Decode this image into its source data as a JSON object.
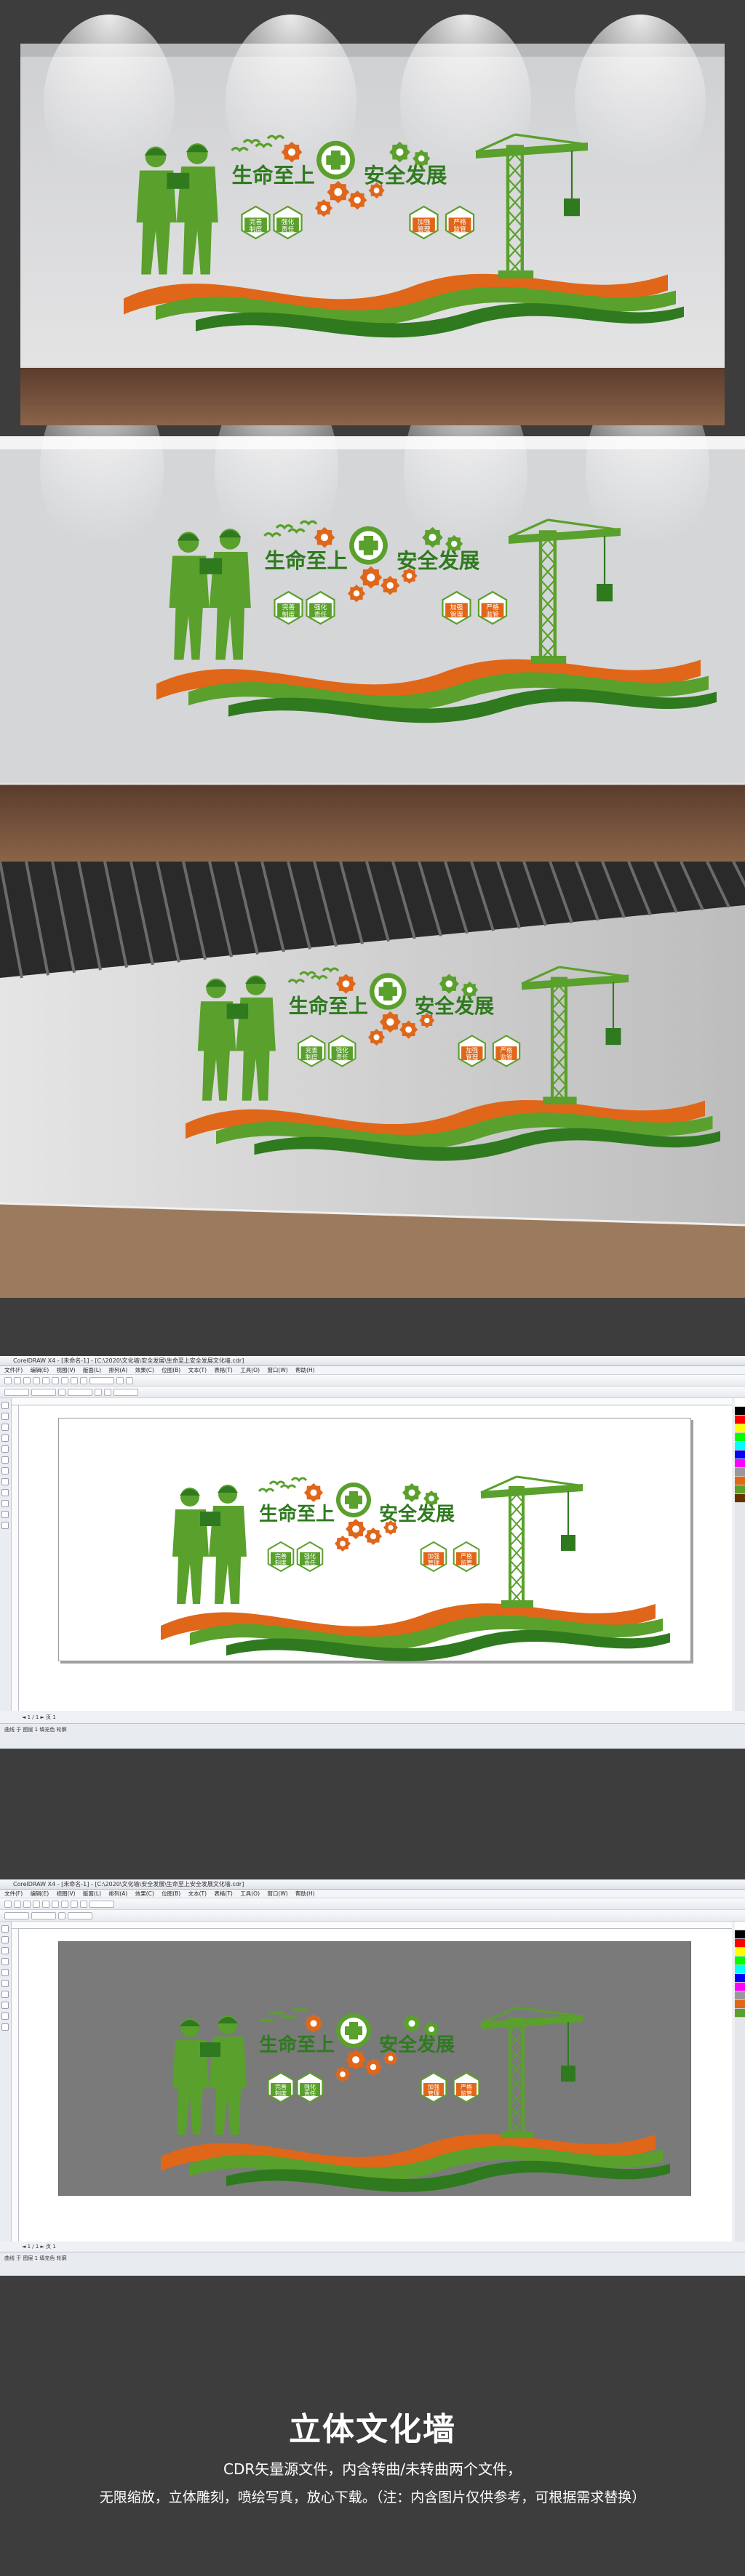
{
  "wall": {
    "slogan_left": "生命至上",
    "slogan_right": "安全发展",
    "hex_labels": [
      [
        "完善",
        "制度"
      ],
      [
        "强化",
        "责任"
      ],
      [
        "加强",
        "管理"
      ],
      [
        "严格",
        "监管"
      ]
    ]
  },
  "cdr": {
    "title": "CorelDRAW X4 - [未命名-1] - [C:\\2020\\文化墙\\安全发展\\生命至上安全发展文化墙.cdr]",
    "menus": [
      "文件(F)",
      "编辑(E)",
      "视图(V)",
      "版面(L)",
      "排列(A)",
      "效果(C)",
      "位图(B)",
      "文本(T)",
      "表格(T)",
      "工具(O)",
      "窗口(W)",
      "帮助(H)"
    ],
    "status_text": "曲线 于 图层 1    填充色   轮廓"
  },
  "footer": {
    "title": "立体文化墙",
    "line1": "CDR矢量源文件，内含转曲/未转曲两个文件，",
    "line2": "无限缩放，立体雕刻，喷绘写真，放心下载。（注：内含图片仅供参考，可根据需求替换）"
  },
  "colors": {
    "green": "#5aa02c",
    "dark_green": "#2f7a1f",
    "orange": "#e0661a",
    "background": "#3d3d3d"
  }
}
